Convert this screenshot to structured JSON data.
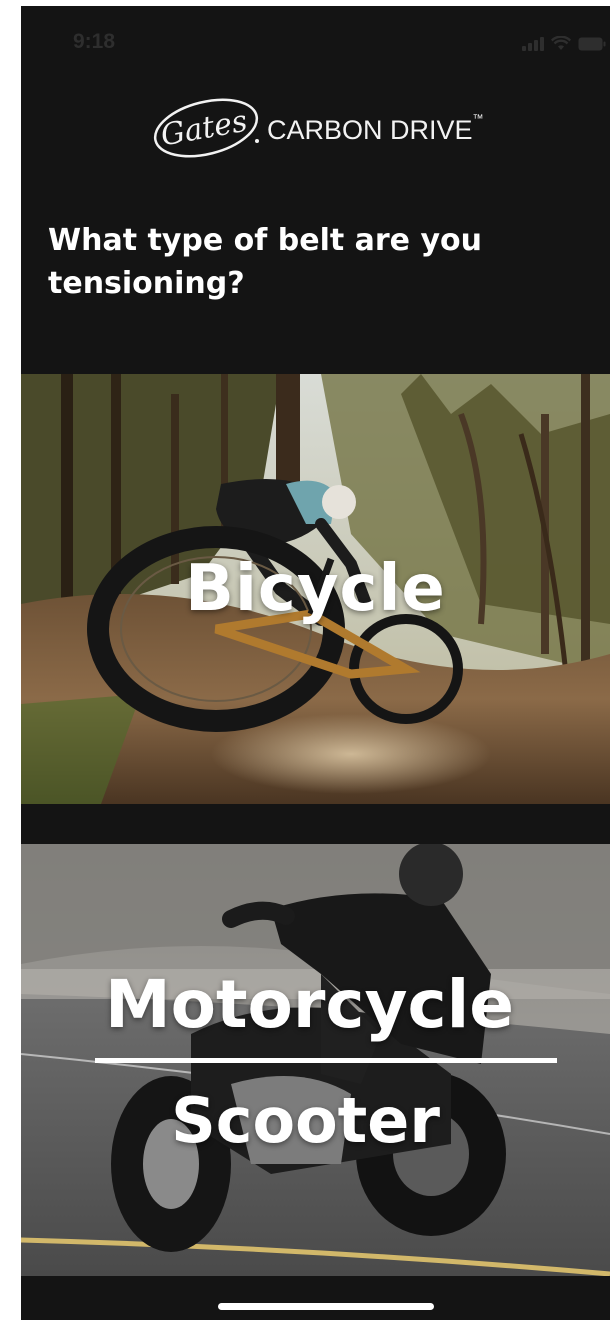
{
  "status_bar": {
    "time": "9:18",
    "icons": [
      "signal-icon",
      "wifi-icon",
      "battery-icon"
    ]
  },
  "header": {
    "logo_script": "Gates",
    "brand_name": "CARBON DRIVE",
    "brand_mark": "™"
  },
  "question": "What type of belt are you tensioning?",
  "options": [
    {
      "label": "Bicycle",
      "image": "mountain-biker-forest-photo"
    },
    {
      "label": "Motorcycle",
      "secondary_label": "Scooter",
      "image": "motorcycle-rider-road-photo"
    }
  ],
  "colors": {
    "background": "#141414",
    "text": "#ffffff"
  }
}
